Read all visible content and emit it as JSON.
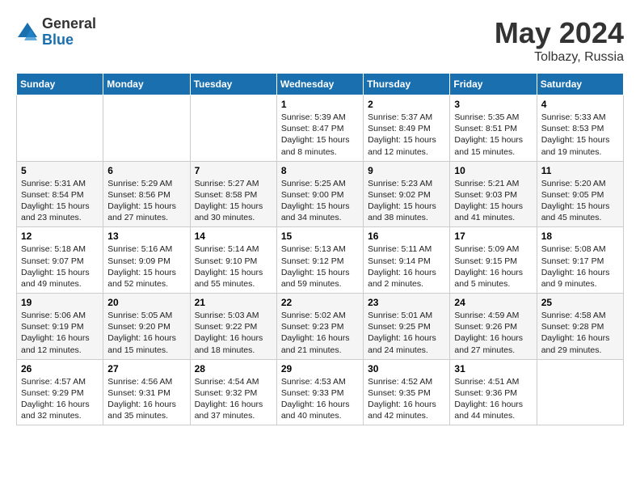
{
  "logo": {
    "general": "General",
    "blue": "Blue"
  },
  "title": "May 2024",
  "location": "Tolbazy, Russia",
  "days_header": [
    "Sunday",
    "Monday",
    "Tuesday",
    "Wednesday",
    "Thursday",
    "Friday",
    "Saturday"
  ],
  "weeks": [
    [
      {
        "day": "",
        "info": ""
      },
      {
        "day": "",
        "info": ""
      },
      {
        "day": "",
        "info": ""
      },
      {
        "day": "1",
        "info": "Sunrise: 5:39 AM\nSunset: 8:47 PM\nDaylight: 15 hours\nand 8 minutes."
      },
      {
        "day": "2",
        "info": "Sunrise: 5:37 AM\nSunset: 8:49 PM\nDaylight: 15 hours\nand 12 minutes."
      },
      {
        "day": "3",
        "info": "Sunrise: 5:35 AM\nSunset: 8:51 PM\nDaylight: 15 hours\nand 15 minutes."
      },
      {
        "day": "4",
        "info": "Sunrise: 5:33 AM\nSunset: 8:53 PM\nDaylight: 15 hours\nand 19 minutes."
      }
    ],
    [
      {
        "day": "5",
        "info": "Sunrise: 5:31 AM\nSunset: 8:54 PM\nDaylight: 15 hours\nand 23 minutes."
      },
      {
        "day": "6",
        "info": "Sunrise: 5:29 AM\nSunset: 8:56 PM\nDaylight: 15 hours\nand 27 minutes."
      },
      {
        "day": "7",
        "info": "Sunrise: 5:27 AM\nSunset: 8:58 PM\nDaylight: 15 hours\nand 30 minutes."
      },
      {
        "day": "8",
        "info": "Sunrise: 5:25 AM\nSunset: 9:00 PM\nDaylight: 15 hours\nand 34 minutes."
      },
      {
        "day": "9",
        "info": "Sunrise: 5:23 AM\nSunset: 9:02 PM\nDaylight: 15 hours\nand 38 minutes."
      },
      {
        "day": "10",
        "info": "Sunrise: 5:21 AM\nSunset: 9:03 PM\nDaylight: 15 hours\nand 41 minutes."
      },
      {
        "day": "11",
        "info": "Sunrise: 5:20 AM\nSunset: 9:05 PM\nDaylight: 15 hours\nand 45 minutes."
      }
    ],
    [
      {
        "day": "12",
        "info": "Sunrise: 5:18 AM\nSunset: 9:07 PM\nDaylight: 15 hours\nand 49 minutes."
      },
      {
        "day": "13",
        "info": "Sunrise: 5:16 AM\nSunset: 9:09 PM\nDaylight: 15 hours\nand 52 minutes."
      },
      {
        "day": "14",
        "info": "Sunrise: 5:14 AM\nSunset: 9:10 PM\nDaylight: 15 hours\nand 55 minutes."
      },
      {
        "day": "15",
        "info": "Sunrise: 5:13 AM\nSunset: 9:12 PM\nDaylight: 15 hours\nand 59 minutes."
      },
      {
        "day": "16",
        "info": "Sunrise: 5:11 AM\nSunset: 9:14 PM\nDaylight: 16 hours\nand 2 minutes."
      },
      {
        "day": "17",
        "info": "Sunrise: 5:09 AM\nSunset: 9:15 PM\nDaylight: 16 hours\nand 5 minutes."
      },
      {
        "day": "18",
        "info": "Sunrise: 5:08 AM\nSunset: 9:17 PM\nDaylight: 16 hours\nand 9 minutes."
      }
    ],
    [
      {
        "day": "19",
        "info": "Sunrise: 5:06 AM\nSunset: 9:19 PM\nDaylight: 16 hours\nand 12 minutes."
      },
      {
        "day": "20",
        "info": "Sunrise: 5:05 AM\nSunset: 9:20 PM\nDaylight: 16 hours\nand 15 minutes."
      },
      {
        "day": "21",
        "info": "Sunrise: 5:03 AM\nSunset: 9:22 PM\nDaylight: 16 hours\nand 18 minutes."
      },
      {
        "day": "22",
        "info": "Sunrise: 5:02 AM\nSunset: 9:23 PM\nDaylight: 16 hours\nand 21 minutes."
      },
      {
        "day": "23",
        "info": "Sunrise: 5:01 AM\nSunset: 9:25 PM\nDaylight: 16 hours\nand 24 minutes."
      },
      {
        "day": "24",
        "info": "Sunrise: 4:59 AM\nSunset: 9:26 PM\nDaylight: 16 hours\nand 27 minutes."
      },
      {
        "day": "25",
        "info": "Sunrise: 4:58 AM\nSunset: 9:28 PM\nDaylight: 16 hours\nand 29 minutes."
      }
    ],
    [
      {
        "day": "26",
        "info": "Sunrise: 4:57 AM\nSunset: 9:29 PM\nDaylight: 16 hours\nand 32 minutes."
      },
      {
        "day": "27",
        "info": "Sunrise: 4:56 AM\nSunset: 9:31 PM\nDaylight: 16 hours\nand 35 minutes."
      },
      {
        "day": "28",
        "info": "Sunrise: 4:54 AM\nSunset: 9:32 PM\nDaylight: 16 hours\nand 37 minutes."
      },
      {
        "day": "29",
        "info": "Sunrise: 4:53 AM\nSunset: 9:33 PM\nDaylight: 16 hours\nand 40 minutes."
      },
      {
        "day": "30",
        "info": "Sunrise: 4:52 AM\nSunset: 9:35 PM\nDaylight: 16 hours\nand 42 minutes."
      },
      {
        "day": "31",
        "info": "Sunrise: 4:51 AM\nSunset: 9:36 PM\nDaylight: 16 hours\nand 44 minutes."
      },
      {
        "day": "",
        "info": ""
      }
    ]
  ]
}
